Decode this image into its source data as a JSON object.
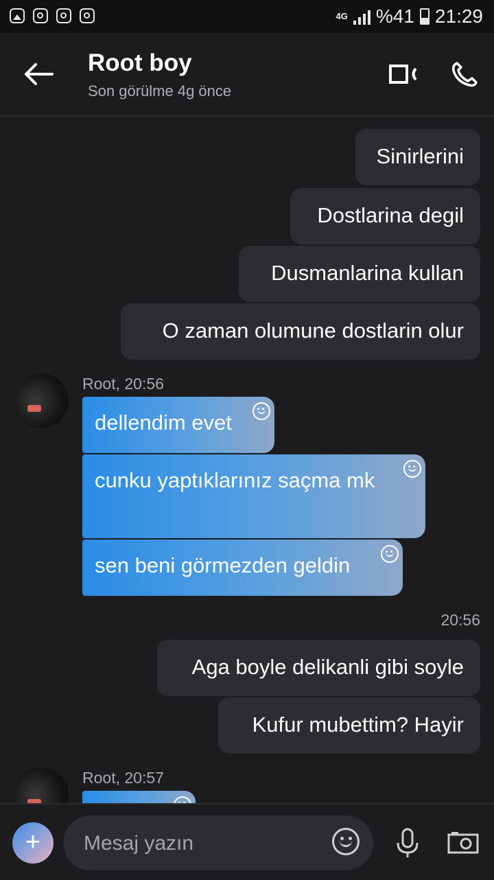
{
  "status_bar": {
    "network": "4G",
    "battery": "%41",
    "time": "21:29",
    "icons": [
      "gallery-icon",
      "instagram-icon",
      "instagram-icon",
      "instagram-icon"
    ]
  },
  "header": {
    "title": "Root boy",
    "subtitle": "Son görülme 4g önce"
  },
  "messages": [
    {
      "dir": "out",
      "text": "Sinirlerini"
    },
    {
      "dir": "out",
      "text": "Dostlarina degil"
    },
    {
      "dir": "out",
      "text": "Dusmanlarina kullan"
    },
    {
      "dir": "out",
      "text": "O zaman olumune dostlarin olur"
    },
    {
      "dir": "in",
      "meta": "Root, 20:56",
      "text": "dellendim evet"
    },
    {
      "dir": "in",
      "text": "cunku yaptıklarınız saçma mk"
    },
    {
      "dir": "in",
      "text": "sen beni görmezden geldin"
    },
    {
      "dir": "out",
      "meta": "20:56",
      "text": "Aga boyle delikanli gibi soyle"
    },
    {
      "dir": "out",
      "text": "Kufur mubettim? Hayir"
    },
    {
      "dir": "in",
      "meta": "Root, 20:57",
      "text": ""
    }
  ],
  "composer": {
    "placeholder": "Mesaj yazın",
    "plus_label": "+"
  },
  "colors": {
    "background": "#1c1c1f",
    "outgoing_bubble": "#2d2d31",
    "incoming_gradient_start": "#2a8ce6",
    "incoming_gradient_end": "#8ea7c9"
  }
}
